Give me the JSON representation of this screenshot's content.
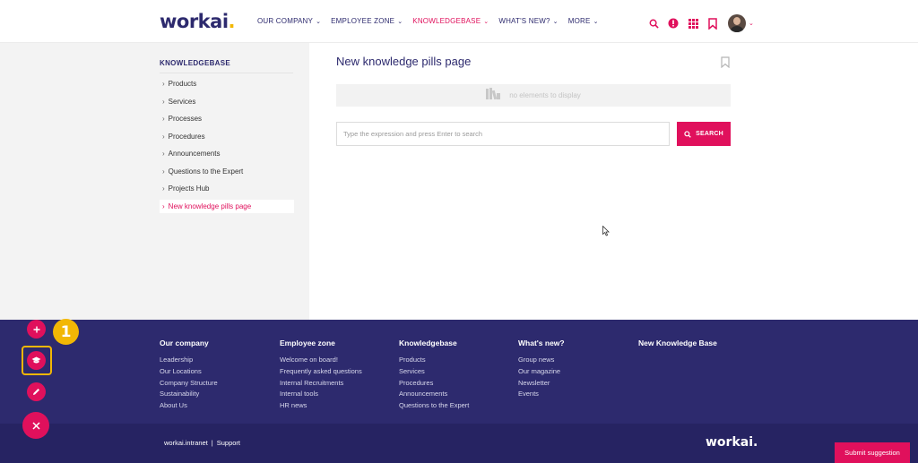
{
  "header": {
    "logo_text": "workai",
    "logo_dot": ".",
    "nav": [
      {
        "label": "OUR COMPANY"
      },
      {
        "label": "EMPLOYEE ZONE"
      },
      {
        "label": "KNOWLEDGEBASE"
      },
      {
        "label": "WHAT'S NEW?"
      },
      {
        "label": "MORE"
      }
    ],
    "active_nav": "KNOWLEDGEBASE",
    "icons": [
      "search-icon",
      "alert-icon",
      "apps-grid-icon",
      "bookmark-icon",
      "avatar"
    ]
  },
  "sidebar": {
    "title": "KNOWLEDGEBASE",
    "items": [
      {
        "label": "Products"
      },
      {
        "label": "Services"
      },
      {
        "label": "Processes"
      },
      {
        "label": "Procedures"
      },
      {
        "label": "Announcements"
      },
      {
        "label": "Questions to the Expert"
      },
      {
        "label": "Projects Hub"
      },
      {
        "label": "New knowledge pills page"
      }
    ],
    "active_item": "New knowledge pills page"
  },
  "main": {
    "page_title": "New knowledge pills page",
    "empty_text": "no elements to display",
    "search_placeholder": "Type the expression and press Enter to search",
    "search_value": "",
    "search_button": "SEARCH"
  },
  "footer": {
    "columns": [
      {
        "title": "Our company",
        "links": [
          "Leadership",
          "Our Locations",
          "Company Structure",
          "Sustainability",
          "About Us"
        ]
      },
      {
        "title": "Employee zone",
        "links": [
          "Welcome on board!",
          "Frequently asked questions",
          "Internal Recruitments",
          "Internal tools",
          "HR news"
        ]
      },
      {
        "title": "Knowledgebase",
        "links": [
          "Products",
          "Services",
          "Procedures",
          "Announcements",
          "Questions to the Expert"
        ]
      },
      {
        "title": "What's new?",
        "links": [
          "Group news",
          "Our magazine",
          "Newsletter",
          "Events"
        ]
      },
      {
        "title": "New Knowledge Base",
        "links": []
      }
    ],
    "copyright_link": "workai.intranet",
    "separator": "|",
    "support_link": "Support",
    "footer_logo": "workai.",
    "submit_button": "Submit suggestion"
  },
  "fab": {
    "badge_number": "1",
    "buttons": [
      "add-icon",
      "knowledge-cap-icon",
      "edit-pencil-icon",
      "close-icon"
    ]
  },
  "colors": {
    "brand_navy": "#2d2a6e",
    "accent_pink": "#e0105c",
    "highlight_yellow": "#f2b705"
  }
}
